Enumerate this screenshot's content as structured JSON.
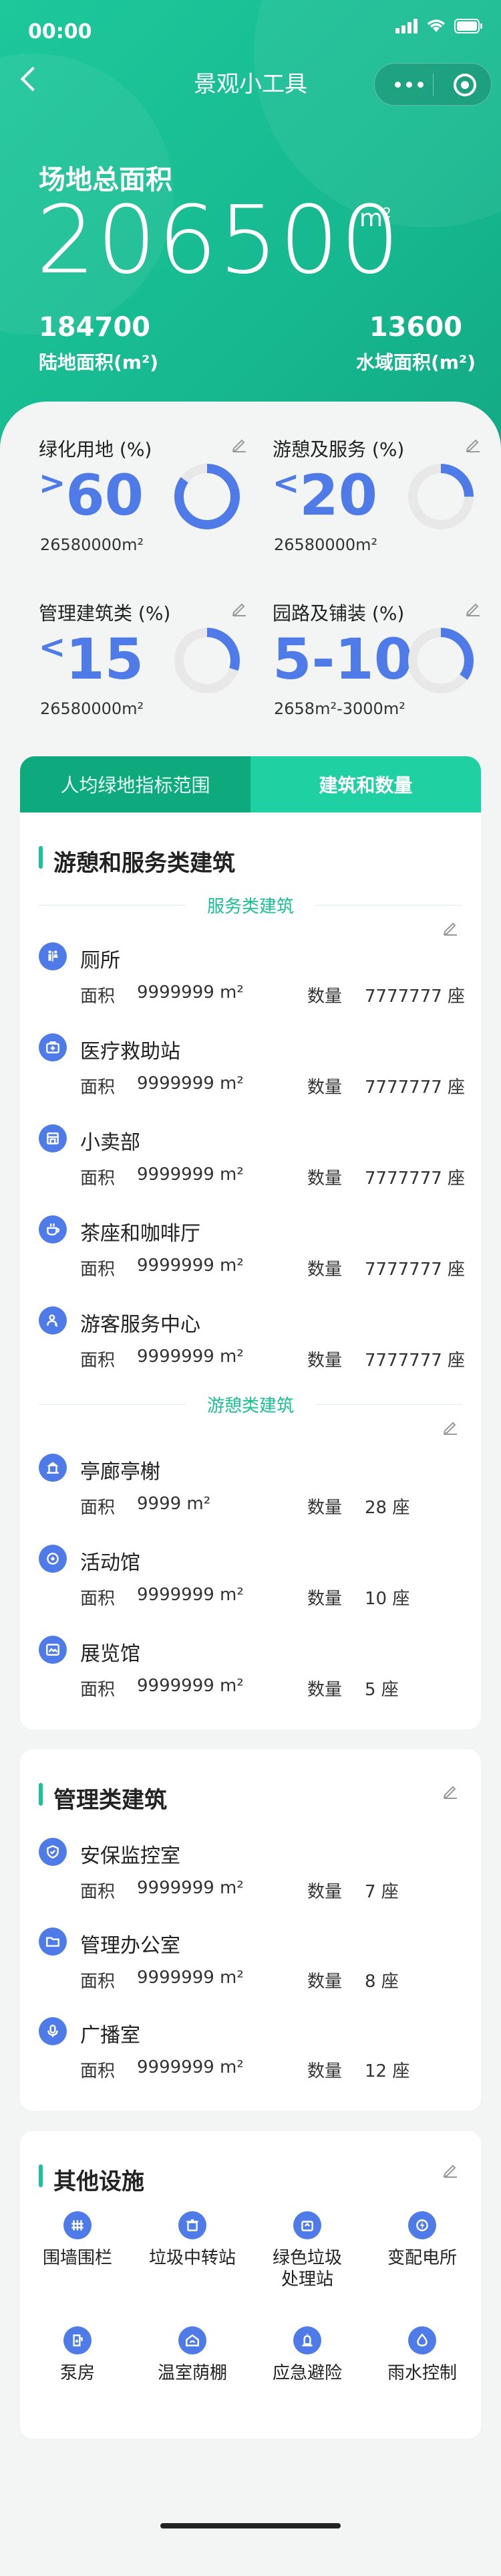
{
  "status": {
    "time": "00:00"
  },
  "nav": {
    "title": "景观小工具"
  },
  "hero": {
    "total_label": "场地总面积",
    "total_value": "206500",
    "total_unit": "m",
    "total_unit_sup": "2",
    "land_value": "184700",
    "land_label": "陆地面积(m²)",
    "water_value": "13600",
    "water_label": "水域面积(m²)"
  },
  "stats": [
    {
      "title": "绿化用地 (%)",
      "sign": ">",
      "value": "60",
      "sub": "26580000m²",
      "ring_fraction": 0.85
    },
    {
      "title": "游憩及服务 (%)",
      "sign": "<",
      "value": "20",
      "sub": "26580000m²",
      "ring_fraction": 0.25
    },
    {
      "title": "管理建筑类 (%)",
      "sign": "<",
      "value": "15",
      "sub": "26580000m²",
      "ring_fraction": 0.3
    },
    {
      "title": "园路及铺装 (%)",
      "sign": "",
      "value": "5-10",
      "sub": "2658m²-3000m²",
      "ring_fraction": 0.35
    }
  ],
  "tabs": [
    {
      "label": "人均绿地指标范围",
      "active": false
    },
    {
      "label": "建筑和数量",
      "active": true
    }
  ],
  "section1": {
    "title": "游憩和服务类建筑",
    "group1_label": "服务类建筑",
    "group1_items": [
      {
        "name": "厕所",
        "area_label": "面积",
        "area": "9999999 m²",
        "qty_label": "数量",
        "qty": "7777777 座",
        "icon": "toilet-icon"
      },
      {
        "name": "医疗救助站",
        "area_label": "面积",
        "area": "9999999 m²",
        "qty_label": "数量",
        "qty": "7777777 座",
        "icon": "medical-kit-icon"
      },
      {
        "name": "小卖部",
        "area_label": "面积",
        "area": "9999999 m²",
        "qty_label": "数量",
        "qty": "7777777 座",
        "icon": "shop-icon"
      },
      {
        "name": "茶座和咖啡厅",
        "area_label": "面积",
        "area": "9999999 m²",
        "qty_label": "数量",
        "qty": "7777777 座",
        "icon": "coffee-icon"
      },
      {
        "name": "游客服务中心",
        "area_label": "面积",
        "area": "9999999 m²",
        "qty_label": "数量",
        "qty": "7777777 座",
        "icon": "service-person-icon"
      }
    ],
    "group2_label": "游憩类建筑",
    "group2_items": [
      {
        "name": "亭廊亭榭",
        "area_label": "面积",
        "area": "9999 m²",
        "qty_label": "数量",
        "qty": "28 座",
        "icon": "pavilion-icon"
      },
      {
        "name": "活动馆",
        "area_label": "面积",
        "area": "9999999 m²",
        "qty_label": "数量",
        "qty": "10 座",
        "icon": "activity-icon"
      },
      {
        "name": "展览馆",
        "area_label": "面积",
        "area": "9999999 m²",
        "qty_label": "数量",
        "qty": "5 座",
        "icon": "exhibition-icon"
      }
    ]
  },
  "section2": {
    "title": "管理类建筑",
    "items": [
      {
        "name": "安保监控室",
        "area_label": "面积",
        "area": "9999999 m²",
        "qty_label": "数量",
        "qty": "7 座",
        "icon": "security-shield-icon"
      },
      {
        "name": "管理办公室",
        "area_label": "面积",
        "area": "9999999 m²",
        "qty_label": "数量",
        "qty": "8 座",
        "icon": "office-folder-icon"
      },
      {
        "name": "广播室",
        "area_label": "面积",
        "area": "9999999 m²",
        "qty_label": "数量",
        "qty": "12 座",
        "icon": "microphone-icon"
      }
    ]
  },
  "section3": {
    "title": "其他设施",
    "items": [
      {
        "label": "围墙围栏",
        "icon": "fence-icon"
      },
      {
        "label": "垃圾中转站",
        "icon": "trash-icon"
      },
      {
        "label": "绿色垃圾\n处理站",
        "icon": "recycle-icon"
      },
      {
        "label": "变配电所",
        "icon": "power-icon"
      },
      {
        "label": "泵房",
        "icon": "pump-icon"
      },
      {
        "label": "温室荫棚",
        "icon": "greenhouse-icon"
      },
      {
        "label": "应急避险",
        "icon": "emergency-icon"
      },
      {
        "label": "雨水控制",
        "icon": "rain-drop-icon"
      }
    ]
  },
  "colors": {
    "accent_green": "#1bc29a",
    "accent_blue": "#4f7be9"
  }
}
